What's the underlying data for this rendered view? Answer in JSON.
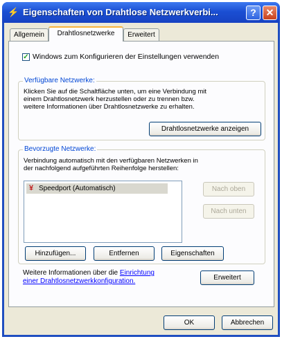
{
  "window": {
    "title": "Eigenschaften von Drahtlose Netzwerkverbi...",
    "help_label": "?",
    "close_label": "✕",
    "icon": "network-icon"
  },
  "tabs": [
    {
      "label": "Allgemein",
      "active": false
    },
    {
      "label": "Drahtlosnetzwerke",
      "active": true
    },
    {
      "label": "Erweitert",
      "active": false
    }
  ],
  "config_checkbox": {
    "label": "Windows zum Konfigurieren der Einstellungen verwenden",
    "checked": true
  },
  "available": {
    "title": "Verfügbare Netzwerke:",
    "line1": "Klicken Sie auf die Schaltfläche unten, um eine Verbindung mit",
    "line2": "einem Drahtlosnetzwerk herzustellen oder zu trennen bzw.",
    "line3": "weitere Informationen über Drahtlosnetzwerke zu erhalten.",
    "button": "Drahtlosnetzwerke anzeigen"
  },
  "preferred": {
    "title": "Bevorzugte Netzwerke:",
    "line1": "Verbindung automatisch mit den verfügbaren Netzwerken in",
    "line2": "der nachfolgend aufgeführten Reihenfolge herstellen:",
    "networks": [
      {
        "label": "Speedport (Automatisch)",
        "icon": "antenna-icon"
      }
    ],
    "move_up": "Nach oben",
    "move_down": "Nach unten",
    "add": "Hinzufügen...",
    "remove": "Entfernen",
    "properties": "Eigenschaften"
  },
  "info": {
    "prefix": "Weitere Informationen über die",
    "link1": "Einrichtung",
    "link2": "einer Drahtlosnetzwerkkonfiguration.",
    "advanced_button": "Erweitert"
  },
  "footer": {
    "ok": "OK",
    "cancel": "Abbrechen"
  }
}
